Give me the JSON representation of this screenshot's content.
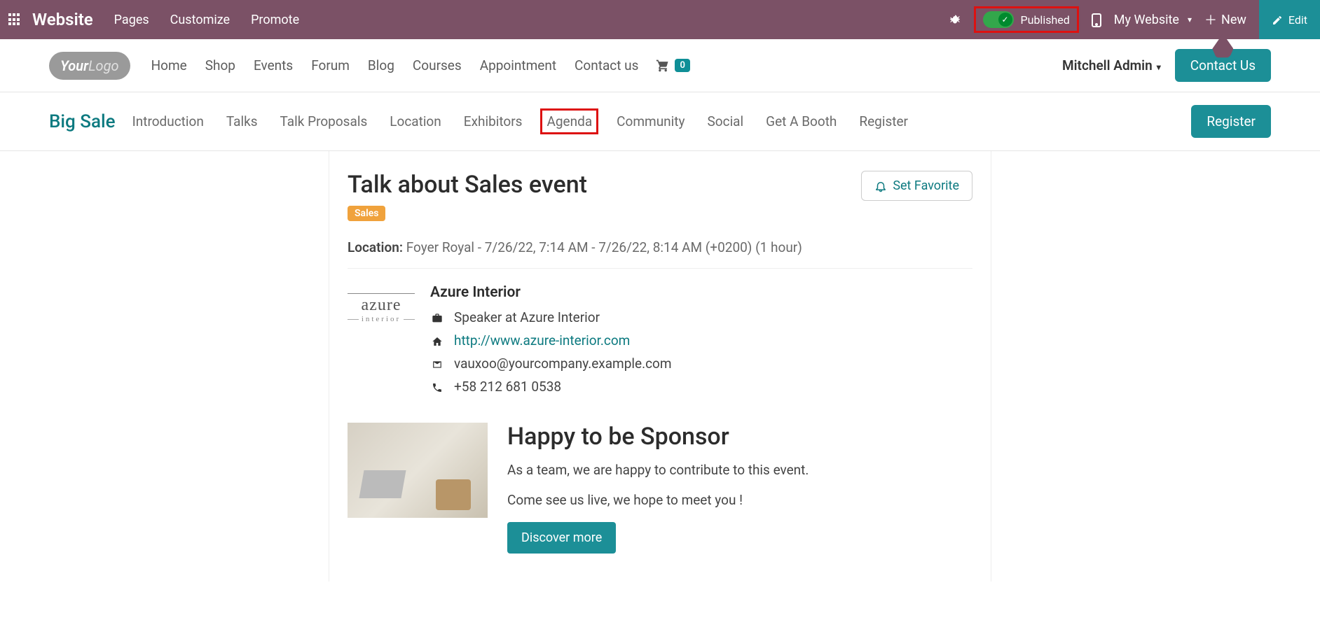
{
  "topbar": {
    "brand": "Website",
    "menu": [
      "Pages",
      "Customize",
      "Promote"
    ],
    "published_label": "Published",
    "my_website": "My Website",
    "new_label": "New",
    "edit_label": "Edit"
  },
  "site_header": {
    "logo_your": "Your",
    "logo_logo": "Logo",
    "nav": [
      "Home",
      "Shop",
      "Events",
      "Forum",
      "Blog",
      "Courses",
      "Appointment",
      "Contact us"
    ],
    "cart_count": "0",
    "user": "Mitchell Admin",
    "contact_btn": "Contact Us"
  },
  "event_nav": {
    "title": "Big Sale",
    "tabs": [
      "Introduction",
      "Talks",
      "Talk Proposals",
      "Location",
      "Exhibitors",
      "Agenda",
      "Community",
      "Social",
      "Get A Booth",
      "Register"
    ],
    "highlighted_index": 5,
    "register_btn": "Register"
  },
  "talk": {
    "title": "Talk about Sales event",
    "tag": "Sales",
    "fav_btn": "Set Favorite",
    "location_label": "Location:",
    "location_value": "Foyer Royal - 7/26/22, 7:14 AM - 7/26/22, 8:14 AM (+0200) (1 hour)"
  },
  "speaker": {
    "company": "Azure Interior",
    "role": "Speaker at Azure Interior",
    "website": "http://www.azure-interior.com",
    "email": "vauxoo@yourcompany.example.com",
    "phone": "+58 212 681 0538",
    "logo_name": "azure",
    "logo_sub": "interior"
  },
  "sponsor": {
    "title": "Happy to be Sponsor",
    "line1": "As a team, we are happy to contribute to this event.",
    "line2": "Come see us live, we hope to meet you !",
    "btn": "Discover more"
  }
}
